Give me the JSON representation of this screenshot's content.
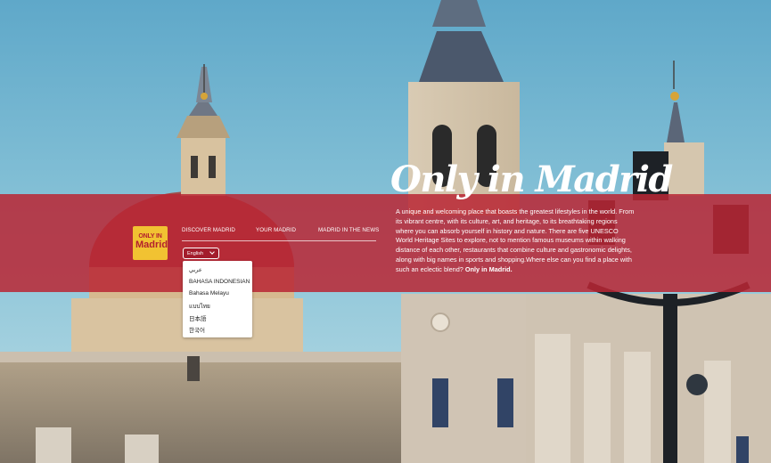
{
  "logo": {
    "line1": "ONLY IN",
    "line2": "Madrid"
  },
  "nav": {
    "items": [
      {
        "label": "DISCOVER MADRID"
      },
      {
        "label": "YOUR MADRID"
      },
      {
        "label": "MADRID IN THE NEWS"
      }
    ]
  },
  "language": {
    "selected": "English",
    "options": [
      "عربي",
      "BAHASA INDONESIAN",
      "Bahasa Melayu",
      "แบบไทย",
      "日本語",
      "한국어"
    ]
  },
  "hero": {
    "title": "Only in Madrid",
    "description": "A unique and welcoming place that boasts the greatest lifestyles in the world. From its vibrant centre, with its culture, art, and heritage, to its breathtaking regions where you can absorb yourself in history and nature. There are five UNESCO World Heritage Sites to explore, not to mention famous museums within walking distance of each other, restaurants that combine culture and gastronomic delights, along with big names in sports and shopping.Where else can you find a place with such an eclectic blend? ",
    "description_bold": "Only in Madrid."
  },
  "colors": {
    "band": "#b92634",
    "logo_bg": "#f1c232",
    "logo_text": "#b3202e"
  }
}
